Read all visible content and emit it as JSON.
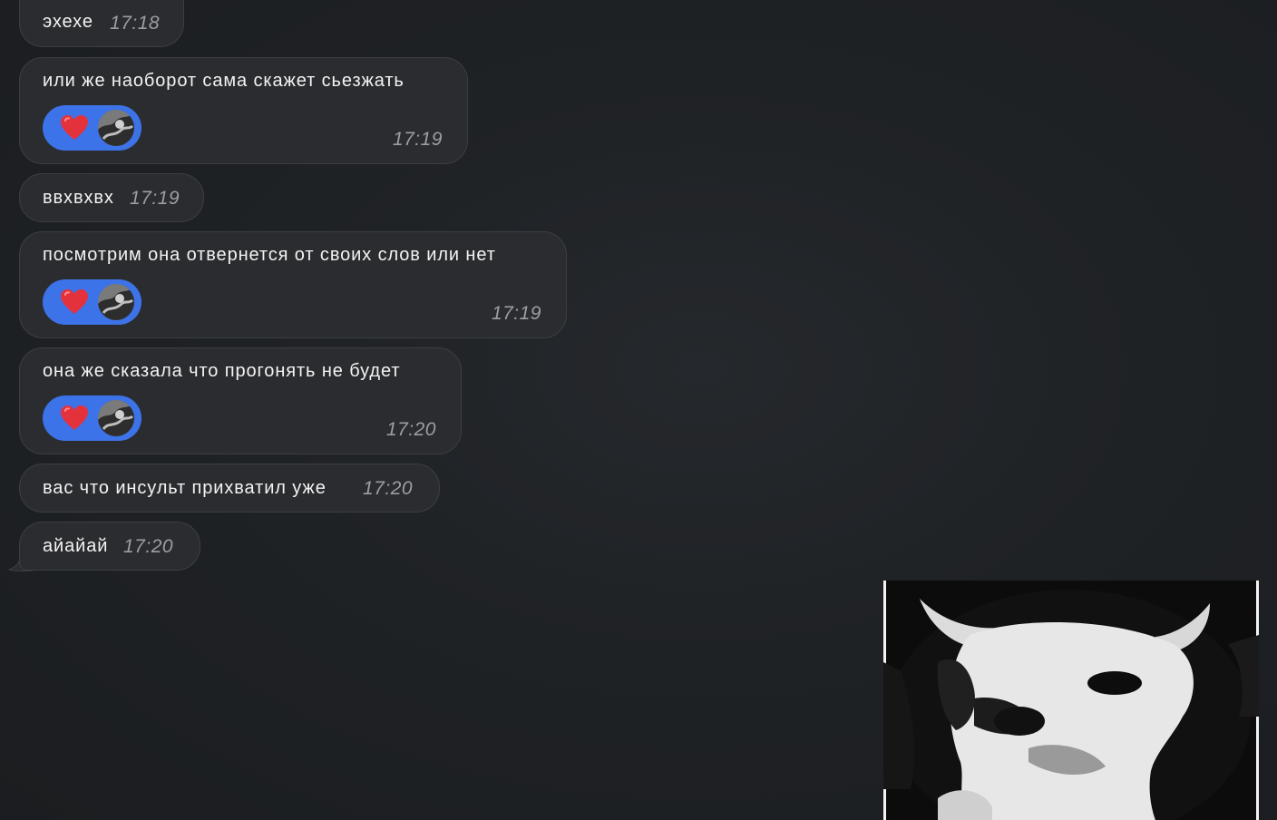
{
  "messages": [
    {
      "text": "эхехе",
      "time": "17:18"
    },
    {
      "text": "или же наоборот сама скажет сьезжать",
      "time": "17:19",
      "reaction": {
        "emoji": "heart-icon",
        "color": "#e3323b"
      }
    },
    {
      "text": "ввхвхвх",
      "time": "17:19"
    },
    {
      "text": "посмотрим она отвернется от своих слов или нет",
      "time": "17:19",
      "reaction": {
        "emoji": "heart-icon",
        "color": "#e3323b"
      }
    },
    {
      "text": "она же сказала что прогонять не будет",
      "time": "17:20",
      "reaction": {
        "emoji": "heart-icon",
        "color": "#e3323b"
      }
    },
    {
      "text": "вас что инсульт прихватил уже",
      "time": "17:20"
    },
    {
      "text": "айайай",
      "time": "17:20"
    }
  ],
  "colors": {
    "background": "#1f2225",
    "bubble": "#2b2c2f",
    "reaction_pill": "#3d73e8",
    "time_text": "#9c9ea3"
  },
  "attachment": {
    "type": "image",
    "icon": "cat-photo"
  }
}
